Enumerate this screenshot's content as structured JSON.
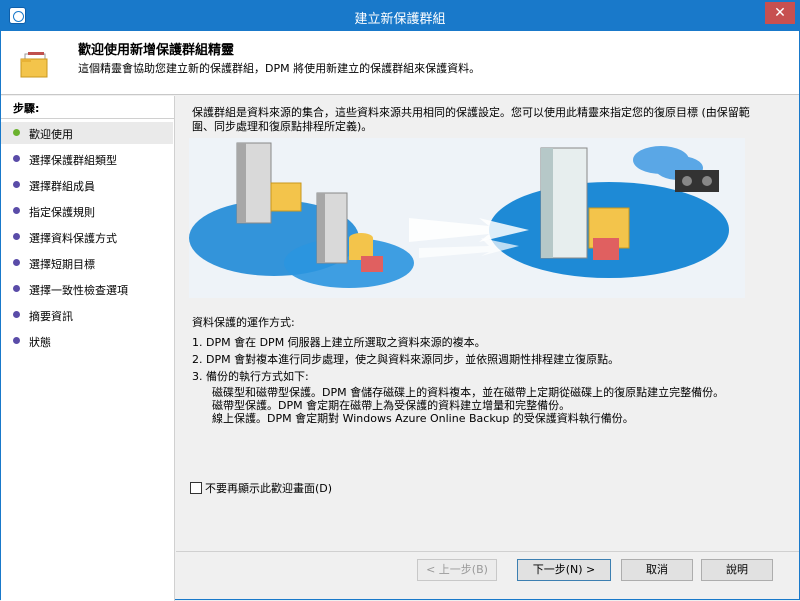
{
  "window": {
    "title": "建立新保護群組",
    "close_glyph": "✕"
  },
  "header": {
    "title": "歡迎使用新增保護群組精靈",
    "description": "這個精靈會協助您建立新的保護群組，DPM 將使用新建立的保護群組來保護資料。"
  },
  "steps": {
    "title": "步驟:",
    "items": [
      {
        "label": "歡迎使用",
        "current": true
      },
      {
        "label": "選擇保護群組類型"
      },
      {
        "label": "選擇群組成員"
      },
      {
        "label": "指定保護規則"
      },
      {
        "label": "選擇資料保護方式"
      },
      {
        "label": "選擇短期目標"
      },
      {
        "label": "選擇一致性檢查選項"
      },
      {
        "label": "摘要資訊"
      },
      {
        "label": "狀態"
      }
    ]
  },
  "content": {
    "intro": "保護群組是資料來源的集合，這些資料來源共用相同的保護設定。您可以使用此精靈來指定您的復原目標 (由保留範圍、同步處理和復原點排程所定義)。",
    "how_title": "資料保護的運作方式:",
    "how_items": [
      {
        "num": "1.",
        "text": "DPM 會在 DPM 伺服器上建立所選取之資料來源的複本。"
      },
      {
        "num": "2.",
        "text": "DPM 會對複本進行同步處理，使之與資料來源同步，並依照週期性排程建立復原點。"
      },
      {
        "num": "3.",
        "text": "備份的執行方式如下:"
      }
    ],
    "backup_methods": [
      "磁碟型和磁帶型保護。DPM 會儲存磁碟上的資料複本，並在磁帶上定期從磁碟上的復原點建立完整備份。",
      "磁帶型保護。DPM 會定期在磁帶上為受保護的資料建立增量和完整備份。",
      "線上保護。DPM 會定期對 Windows Azure Online Backup 的受保護資料執行備份。"
    ],
    "dont_show_label": "不要再顯示此歡迎畫面(D)"
  },
  "buttons": {
    "back": "< 上一步(B)",
    "next": "下一步(N) >",
    "cancel": "取消",
    "help": "說明"
  },
  "colors": {
    "titlebar": "#1979ca",
    "current_step_dot": "#6bb22e",
    "step_dot": "#5a4ca8"
  }
}
